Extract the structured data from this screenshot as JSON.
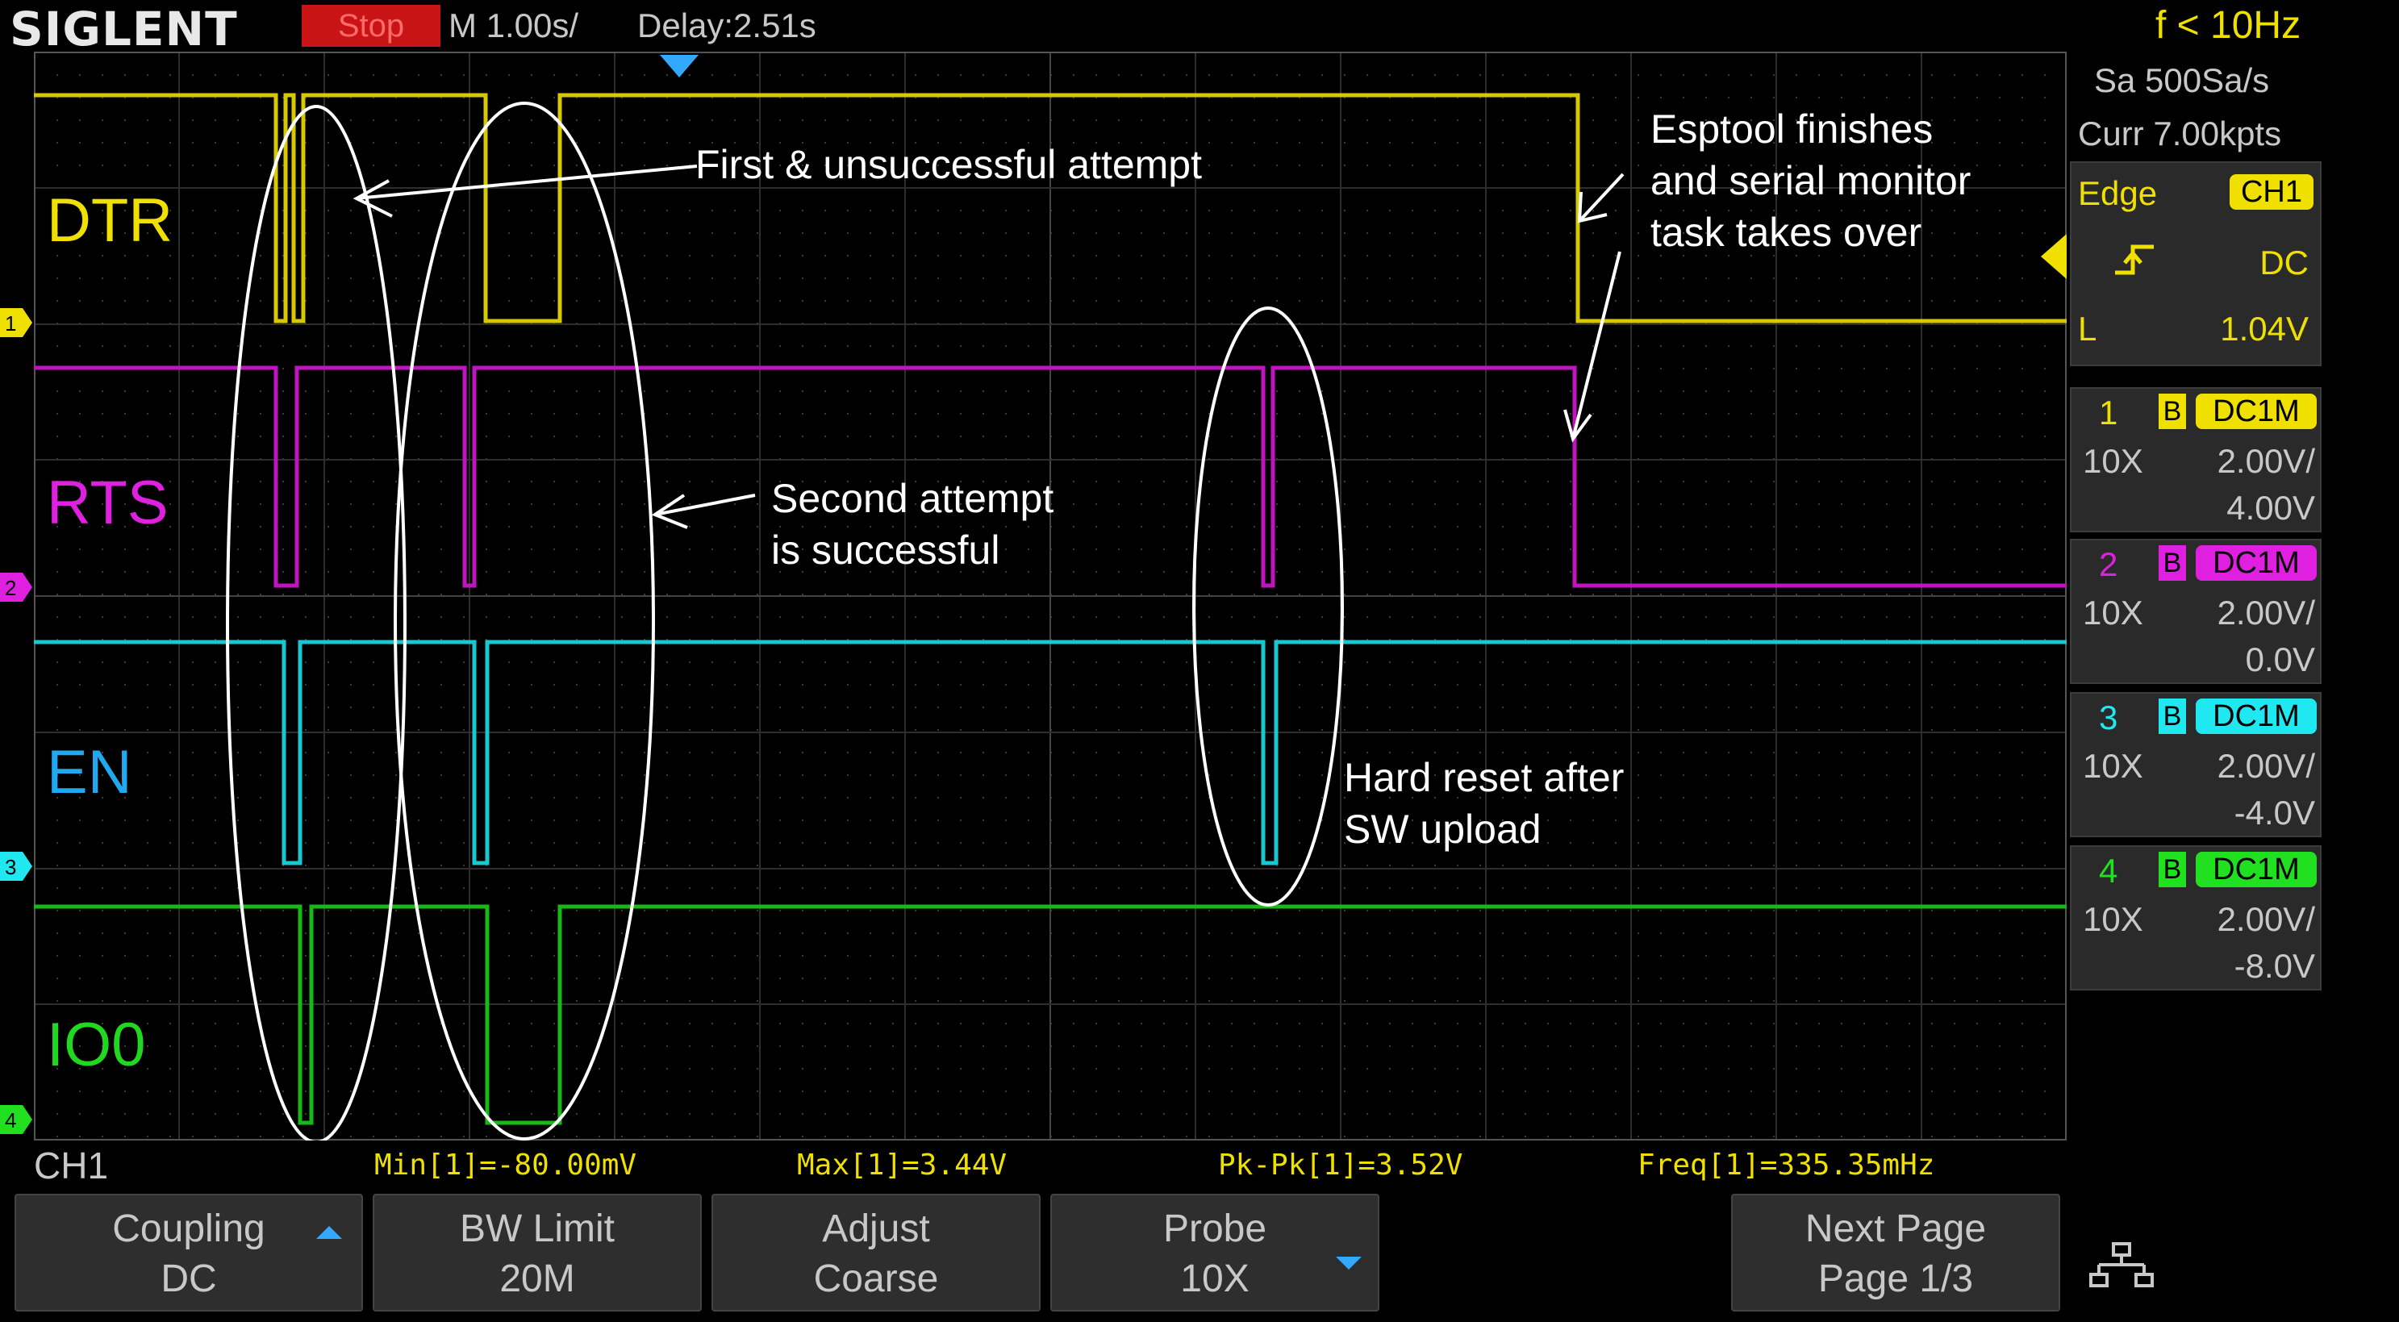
{
  "header": {
    "brand": "SIGLENT",
    "run_state": "Stop",
    "timebase": "M 1.00s/",
    "delay": "Delay:2.51s",
    "trigger_freq": "f < 10Hz"
  },
  "acquisition": {
    "sample_rate": "Sa 500Sa/s",
    "current_points": "Curr 7.00kpts"
  },
  "trigger": {
    "type": "Edge",
    "source": "CH1",
    "slope_icon": "rising-edge-icon",
    "coupling": "DC",
    "level_label": "L",
    "level_value": "1.04V"
  },
  "channels": [
    {
      "number": "1",
      "bw": "B",
      "coupling": "DC1M",
      "probe": "10X",
      "scale": "2.00V/",
      "offset": "4.00V",
      "color": "#f0e000"
    },
    {
      "number": "2",
      "bw": "B",
      "coupling": "DC1M",
      "probe": "10X",
      "scale": "2.00V/",
      "offset": "0.0V",
      "color": "#e020e0"
    },
    {
      "number": "3",
      "bw": "B",
      "coupling": "DC1M",
      "probe": "10X",
      "scale": "2.00V/",
      "offset": "-4.0V",
      "color": "#20e8f0"
    },
    {
      "number": "4",
      "bw": "B",
      "coupling": "DC1M",
      "probe": "10X",
      "scale": "2.00V/",
      "offset": "-8.0V",
      "color": "#20e020"
    }
  ],
  "signal_labels": [
    {
      "text": "DTR",
      "color": "#f0e000"
    },
    {
      "text": "RTS",
      "color": "#e020e0"
    },
    {
      "text": "EN",
      "color": "#20a8f0"
    },
    {
      "text": "IO0",
      "color": "#20d820"
    }
  ],
  "annotations": {
    "first_attempt": "First & unsuccessful attempt",
    "second_attempt_1": "Second attempt",
    "second_attempt_2": "is successful",
    "hard_reset_1": "Hard reset after",
    "hard_reset_2": "SW upload",
    "esptool_1": "Esptool finishes",
    "esptool_2": "and serial monitor",
    "esptool_3": "task takes over"
  },
  "measurements": {
    "channel": "CH1",
    "min": "Min[1]=-80.00mV",
    "max": "Max[1]=3.44V",
    "pkpk": "Pk-Pk[1]=3.52V",
    "freq": "Freq[1]=335.35mHz"
  },
  "softkeys": [
    {
      "line1": "Coupling",
      "line2": "DC"
    },
    {
      "line1": "BW Limit",
      "line2": "20M"
    },
    {
      "line1": "Adjust",
      "line2": "Coarse"
    },
    {
      "line1": "Probe",
      "line2": "10X"
    },
    {
      "line1": "Next Page",
      "line2": "Page 1/3"
    }
  ],
  "icons": {
    "network": "network-icon",
    "trigger_position": "trigger-position-marker-icon",
    "trigger_level": "trigger-level-marker-icon"
  }
}
